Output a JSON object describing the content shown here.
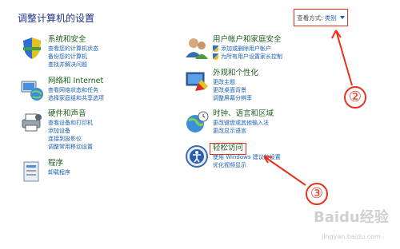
{
  "page": {
    "title": "调整计算机的设置"
  },
  "view": {
    "label": "查看方式:",
    "value": "类别"
  },
  "left_categories": [
    {
      "title": "系统和安全",
      "links": [
        "查看您的计算机状态",
        "备份您的计算机",
        "查找并解决问题"
      ]
    },
    {
      "title": "网络和 Internet",
      "links": [
        "查看网络状态和任务",
        "选择家庭组和共享选项"
      ]
    },
    {
      "title": "硬件和声音",
      "links": [
        "查看设备和打印机",
        "添加设备",
        "连接到投影仪",
        "调整常用移动设置"
      ]
    },
    {
      "title": "程序",
      "links": [
        "卸载程序"
      ]
    }
  ],
  "right_categories": [
    {
      "title": "用户帐户和家庭安全",
      "links": [
        "添加或删除用户帐户",
        "为所有用户设置家长控制"
      ]
    },
    {
      "title": "外观和个性化",
      "links": [
        "更改主题",
        "更改桌面背景",
        "调整屏幕分辨率"
      ]
    },
    {
      "title": "时钟、语言和区域",
      "links": [
        "更改键盘或其他输入法",
        "更改显示语言"
      ]
    },
    {
      "title": "轻松访问",
      "links": [
        "使用 Windows 建议的设置",
        "优化视频显示"
      ]
    }
  ],
  "annotations": {
    "step2": "②",
    "step3": "③"
  },
  "watermark": {
    "text": "Baidu经验",
    "sub": "jingyan.baidu.com"
  },
  "colors": {
    "annotation_red": "#e8301c",
    "link_blue": "#1a5fb4",
    "title_green": "#1e5e1e"
  }
}
